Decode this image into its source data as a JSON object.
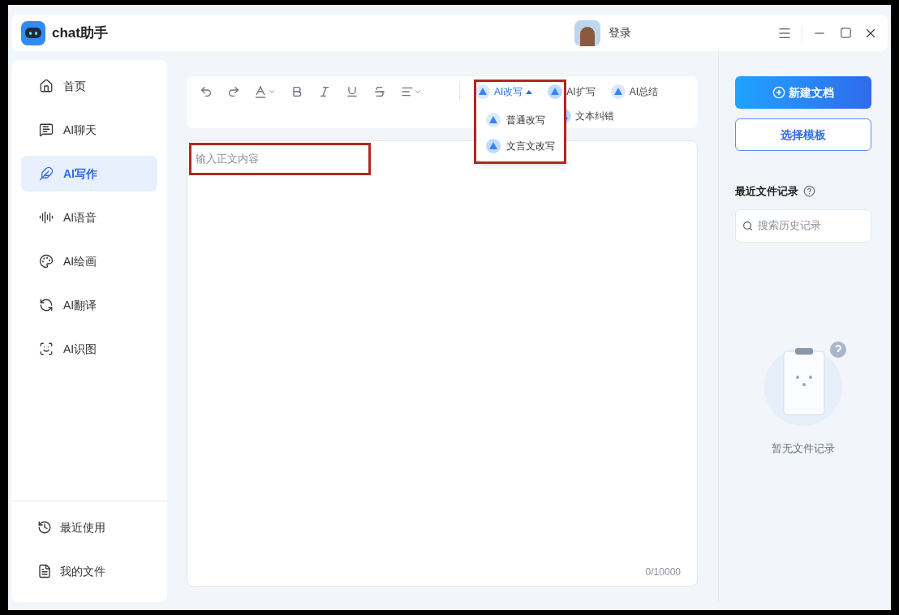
{
  "app": {
    "title": "chat助手",
    "login": "登录"
  },
  "sidebar": {
    "items": [
      {
        "label": "首页",
        "selected": false
      },
      {
        "label": "AI聊天",
        "selected": false
      },
      {
        "label": "AI写作",
        "selected": true
      },
      {
        "label": "AI语音",
        "selected": false
      },
      {
        "label": "AI绘画",
        "selected": false
      },
      {
        "label": "AI翻译",
        "selected": false
      },
      {
        "label": "AI识图",
        "selected": false
      }
    ],
    "bottom_items": [
      {
        "label": "最近使用"
      },
      {
        "label": "我的文件"
      }
    ]
  },
  "ai_tools": [
    {
      "label": "AI改写",
      "expanded": true
    },
    {
      "label": "AI扩写",
      "expanded": false
    },
    {
      "label": "AI总结",
      "expanded": false
    },
    {
      "label": "文本纠错",
      "expanded": false
    }
  ],
  "dropdown": {
    "items": [
      {
        "label": "普通改写"
      },
      {
        "label": "文言文改写"
      }
    ]
  },
  "editor": {
    "placeholder": "输入正文内容",
    "counter": "0/10000"
  },
  "right_panel": {
    "new_doc": "新建文档",
    "template": "选择模板",
    "recent_title": "最近文件记录",
    "search_placeholder": "搜索历史记录",
    "empty": "暂无文件记录"
  }
}
